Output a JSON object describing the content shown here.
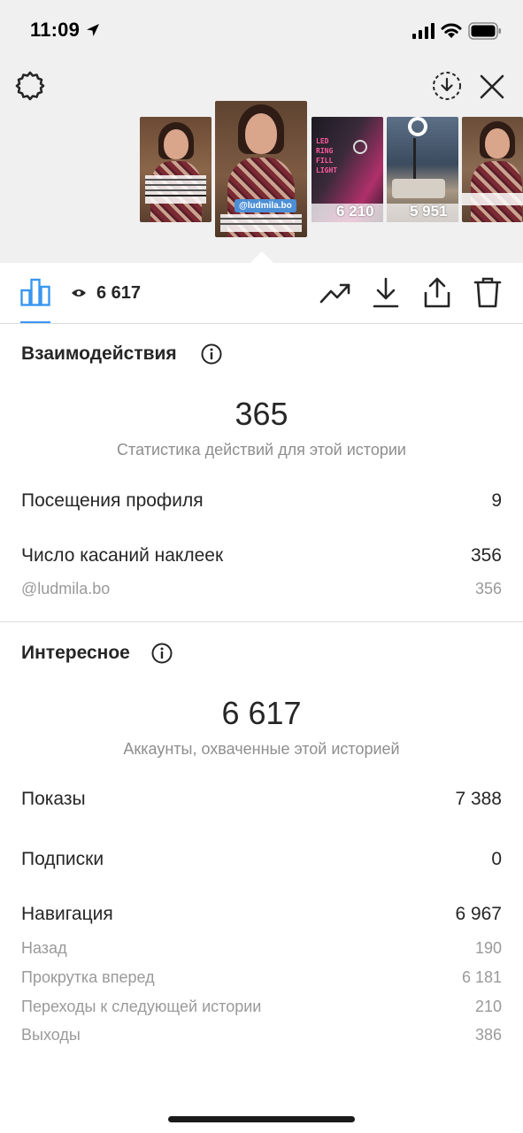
{
  "status_bar": {
    "time": "11:09"
  },
  "stories": [
    {
      "views": ""
    },
    {
      "tag": "@ludmila.bo"
    },
    {
      "views": "6 210",
      "overlay_text": "LED RING FILL LIGHT"
    },
    {
      "views": "5 951"
    },
    {
      "views": ""
    }
  ],
  "toolbar": {
    "view_count": "6 617"
  },
  "interactions": {
    "title": "Взаимодействия",
    "total": "365",
    "total_caption": "Статистика действий для этой истории",
    "rows": [
      {
        "label": "Посещения профиля",
        "value": "9"
      },
      {
        "label": "Число касаний наклеек",
        "value": "356"
      }
    ],
    "sticker_rows": [
      {
        "label": "@ludmila.bo",
        "value": "356"
      }
    ]
  },
  "discovery": {
    "title": "Интересное",
    "total": "6 617",
    "total_caption": "Аккаунты, охваченные этой историей",
    "rows": [
      {
        "label": "Показы",
        "value": "7 388"
      },
      {
        "label": "Подписки",
        "value": "0"
      },
      {
        "label": "Навигация",
        "value": "6 967"
      }
    ],
    "navigation_rows": [
      {
        "label": "Назад",
        "value": "190"
      },
      {
        "label": "Прокрутка вперед",
        "value": "6 181"
      },
      {
        "label": "Переходы к следующей истории",
        "value": "210"
      },
      {
        "label": "Выходы",
        "value": "386"
      }
    ]
  },
  "colors": {
    "accent": "#3897f0",
    "text": "#262626",
    "secondary": "#8e8e8e"
  }
}
